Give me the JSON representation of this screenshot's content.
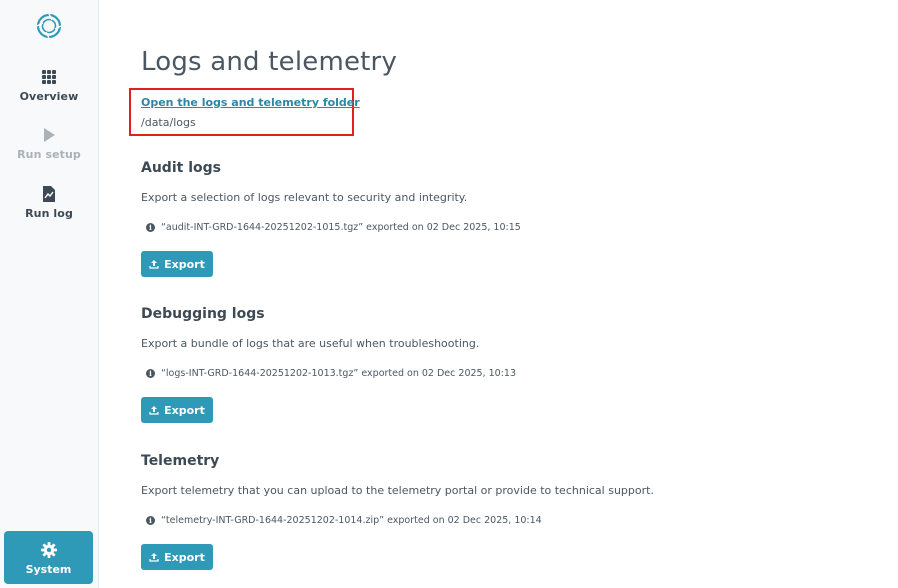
{
  "sidebar": {
    "items": [
      {
        "label": "Overview",
        "icon": "grid-icon",
        "state": "enabled"
      },
      {
        "label": "Run setup",
        "icon": "play-icon",
        "state": "disabled"
      },
      {
        "label": "Run log",
        "icon": "document-icon",
        "state": "enabled"
      }
    ],
    "system": {
      "label": "System",
      "icon": "gear-icon",
      "state": "active"
    }
  },
  "main": {
    "title": "Logs and telemetry",
    "folder_link": "Open the logs and telemetry folder",
    "folder_path": "/data/logs",
    "sections": [
      {
        "heading": "Audit logs",
        "description": "Export a selection of logs relevant to security and integrity.",
        "last_export": "“audit-INT-GRD-1644-20251202-1015.tgz” exported on 02 Dec 2025, 10:15",
        "button": "Export"
      },
      {
        "heading": "Debugging logs",
        "description": "Export a bundle of logs that are useful when troubleshooting.",
        "last_export": "“logs-INT-GRD-1644-20251202-1013.tgz” exported on 02 Dec 2025, 10:13",
        "button": "Export"
      },
      {
        "heading": "Telemetry",
        "description": "Export telemetry that you can upload to the telemetry portal or provide to technical support.",
        "last_export": "“telemetry-INT-GRD-1644-20251202-1014.zip” exported on 02 Dec 2025, 10:14",
        "button": "Export"
      }
    ]
  },
  "colors": {
    "accent": "#2e9ab8",
    "highlight": "#e0201b",
    "text": "#3d4a55",
    "sidebar_bg": "#f8f9fa"
  }
}
